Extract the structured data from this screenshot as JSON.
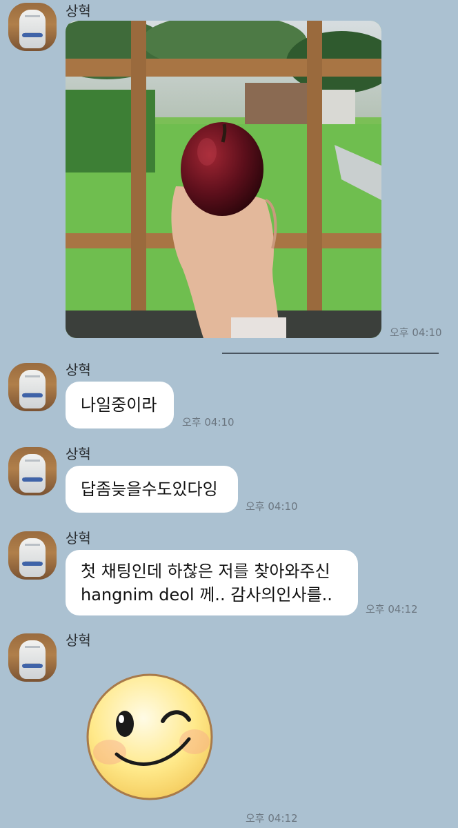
{
  "sender": {
    "name": "상혁"
  },
  "messages": [
    {
      "id": "photo",
      "time": "오후 04:10"
    },
    {
      "id": "m1",
      "text": "나일중이라",
      "time": "오후 04:10"
    },
    {
      "id": "m2",
      "text": "답좀늦을수도있다잉",
      "time": "오후 04:10"
    },
    {
      "id": "m3",
      "line1": "첫 채팅인데 하찮은 저를 찾아와주신",
      "line2": "hangnim deol 께.. 감사의인사를..",
      "time": "오후 04:12"
    },
    {
      "id": "emoji",
      "time": "오후 04:12"
    }
  ],
  "colors": {
    "background": "#abc1d1",
    "bubble": "#ffffff"
  }
}
